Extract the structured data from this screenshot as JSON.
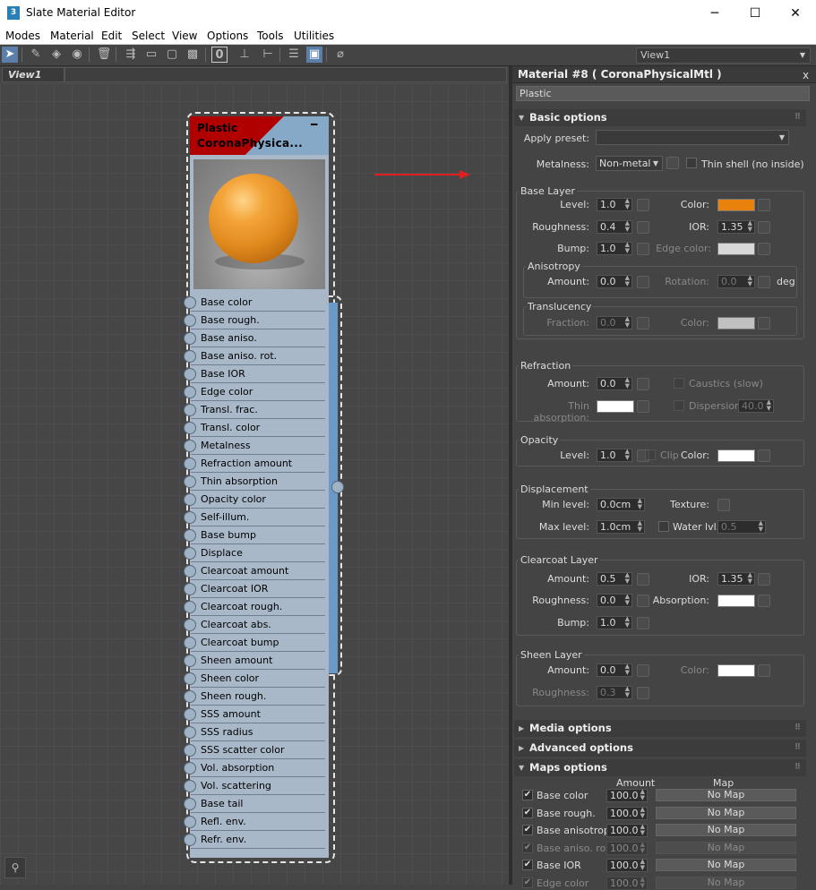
{
  "window": {
    "title": "Slate Material Editor",
    "minimize": "─",
    "maximize": "☐",
    "close": "✕",
    "app_icon": "3"
  },
  "menu": [
    "Modes",
    "Material",
    "Edit",
    "Select",
    "View",
    "Options",
    "Tools",
    "Utilities"
  ],
  "toolbar": {
    "view_select": "View1",
    "icons": [
      "select-arrow-icon",
      "eyedropper-icon",
      "put-to-scene-icon",
      "assign-material-icon",
      "delete-icon",
      "move-children-icon",
      "hide-unused-slots-icon",
      "show-shaded-icon",
      "show-background-icon",
      "show-end-result-icon",
      "layout-all-icon",
      "layout-children-icon",
      "material-id-icon",
      "show-map-in-viewport-icon",
      "lock-icon"
    ]
  },
  "view": {
    "tab_label": "View1",
    "nav_icon": "binoculars-icon"
  },
  "node": {
    "name": "Plastic",
    "type": "CoronaPhysica...",
    "minimize": "━",
    "slots": [
      "Base color",
      "Base rough.",
      "Base aniso.",
      "Base aniso. rot.",
      "Base IOR",
      "Edge color",
      "Transl. frac.",
      "Transl. color",
      "Metalness",
      "Refraction amount",
      "Thin absorption",
      "Opacity color",
      "Self-illum.",
      "Base bump",
      "Displace",
      "Clearcoat amount",
      "Clearcoat IOR",
      "Clearcoat rough.",
      "Clearcoat abs.",
      "Clearcoat bump",
      "Sheen amount",
      "Sheen color",
      "Sheen rough.",
      "SSS amount",
      "SSS radius",
      "SSS scatter color",
      "Vol. absorption",
      "Vol. scattering",
      "Base tail",
      "Refl. env.",
      "Refr. env."
    ]
  },
  "panel": {
    "title": "Material #8  ( CoronaPhysicalMtl )",
    "close": "x",
    "material_name": "Plastic",
    "basic_options": {
      "header": "Basic options",
      "apply_preset_label": "Apply preset:",
      "apply_preset_value": "",
      "metalness_label": "Metalness:",
      "metalness_value": "Non-metal",
      "thin_shell_label": "Thin shell (no inside)",
      "base_layer": {
        "title": "Base Layer",
        "level_label": "Level:",
        "level": "1.0",
        "color_label": "Color:",
        "roughness_label": "Roughness:",
        "roughness": "0.4",
        "ior_label": "IOR:",
        "ior": "1.35",
        "bump_label": "Bump:",
        "bump": "1.0",
        "edge_color_label": "Edge color:"
      },
      "anisotropy": {
        "title": "Anisotropy",
        "amount_label": "Amount:",
        "amount": "0.0",
        "rotation_label": "Rotation:",
        "rotation": "0.0",
        "unit": "deg"
      },
      "translucency": {
        "title": "Translucency",
        "fraction_label": "Fraction:",
        "fraction": "0.0",
        "color_label": "Color:"
      },
      "refraction": {
        "title": "Refraction",
        "amount_label": "Amount:",
        "amount": "0.0",
        "caustics_label": "Caustics (slow)",
        "thin_absorption_label": "Thin absorption:",
        "dispersion_label": "Dispersion",
        "dispersion": "40.0"
      },
      "opacity": {
        "title": "Opacity",
        "level_label": "Level:",
        "level": "1.0",
        "clip_label": "Clip",
        "color_label": "Color:"
      },
      "displacement": {
        "title": "Displacement",
        "min_label": "Min level:",
        "min": "0.0cm",
        "texture_label": "Texture:",
        "max_label": "Max level:",
        "max": "1.0cm",
        "water_label": "Water lvl.",
        "water": "0.5"
      },
      "clearcoat": {
        "title": "Clearcoat Layer",
        "amount_label": "Amount:",
        "amount": "0.5",
        "ior_label": "IOR:",
        "ior": "1.35",
        "roughness_label": "Roughness:",
        "roughness": "0.0",
        "absorption_label": "Absorption:",
        "bump_label": "Bump:",
        "bump": "1.0"
      },
      "sheen": {
        "title": "Sheen Layer",
        "amount_label": "Amount:",
        "amount": "0.0",
        "color_label": "Color:",
        "roughness_label": "Roughness:",
        "roughness": "0.3"
      }
    },
    "media_options": "Media options",
    "advanced_options": "Advanced options",
    "maps_options": {
      "header": "Maps options",
      "col_amount": "Amount",
      "col_map": "Map",
      "rows": [
        {
          "label": "Base color",
          "amount": "100.0",
          "map": "No Map",
          "enabled": true
        },
        {
          "label": "Base rough.",
          "amount": "100.0",
          "map": "No Map",
          "enabled": true
        },
        {
          "label": "Base anisotropy",
          "amount": "100.0",
          "map": "No Map",
          "enabled": true
        },
        {
          "label": "Base aniso. rot.",
          "amount": "100.0",
          "map": "No Map",
          "enabled": false
        },
        {
          "label": "Base IOR",
          "amount": "100.0",
          "map": "No Map",
          "enabled": true
        },
        {
          "label": "Edge color",
          "amount": "100.0",
          "map": "No Map",
          "enabled": false
        }
      ]
    }
  },
  "colors": {
    "base_color": "#e8820c",
    "edge_color": "#d8d8d8",
    "transl_color": "#c0c0c0",
    "thin_absorption": "#ffffff",
    "opacity_color": "#ffffff",
    "clearcoat_absorption": "#ffffff",
    "sheen_color": "#ffffff",
    "header_red": "#b00000",
    "header_blue": "#87a9c8"
  }
}
